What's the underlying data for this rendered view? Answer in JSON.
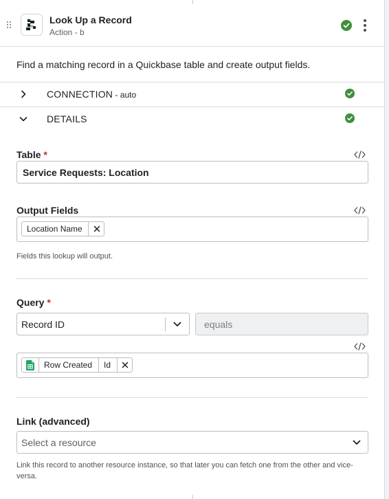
{
  "header": {
    "title": "Look Up a Record",
    "subtitle": "Action - b",
    "status_icon": "check-circle-icon",
    "menu_icon": "kebab-menu-icon"
  },
  "description": "Find a matching record in a Quickbase table and create output fields.",
  "sections": {
    "connection": {
      "label": "CONNECTION",
      "sublabel": " - auto",
      "expanded": false
    },
    "details": {
      "label": "DETAILS",
      "expanded": true
    }
  },
  "table_field": {
    "label": "Table",
    "required_mark": "*",
    "value": "Service Requests: Location"
  },
  "output_fields": {
    "label": "Output Fields",
    "tags": [
      "Location Name"
    ],
    "help": "Fields this lookup will output."
  },
  "query": {
    "label": "Query",
    "required_mark": "*",
    "field_select": "Record ID",
    "operator": "equals",
    "value_tag": {
      "app": "Row Created",
      "field": "Id",
      "icon": "google-sheets-icon"
    }
  },
  "link": {
    "label": "Link (advanced)",
    "placeholder": "Select a resource",
    "help": "Link this record to another resource instance, so that later you can fetch one from the other and vice-versa."
  },
  "colors": {
    "success": "#3f8f3c",
    "required": "#c62828",
    "border": "#b9bdc3",
    "sheets_green": "#21a464"
  }
}
